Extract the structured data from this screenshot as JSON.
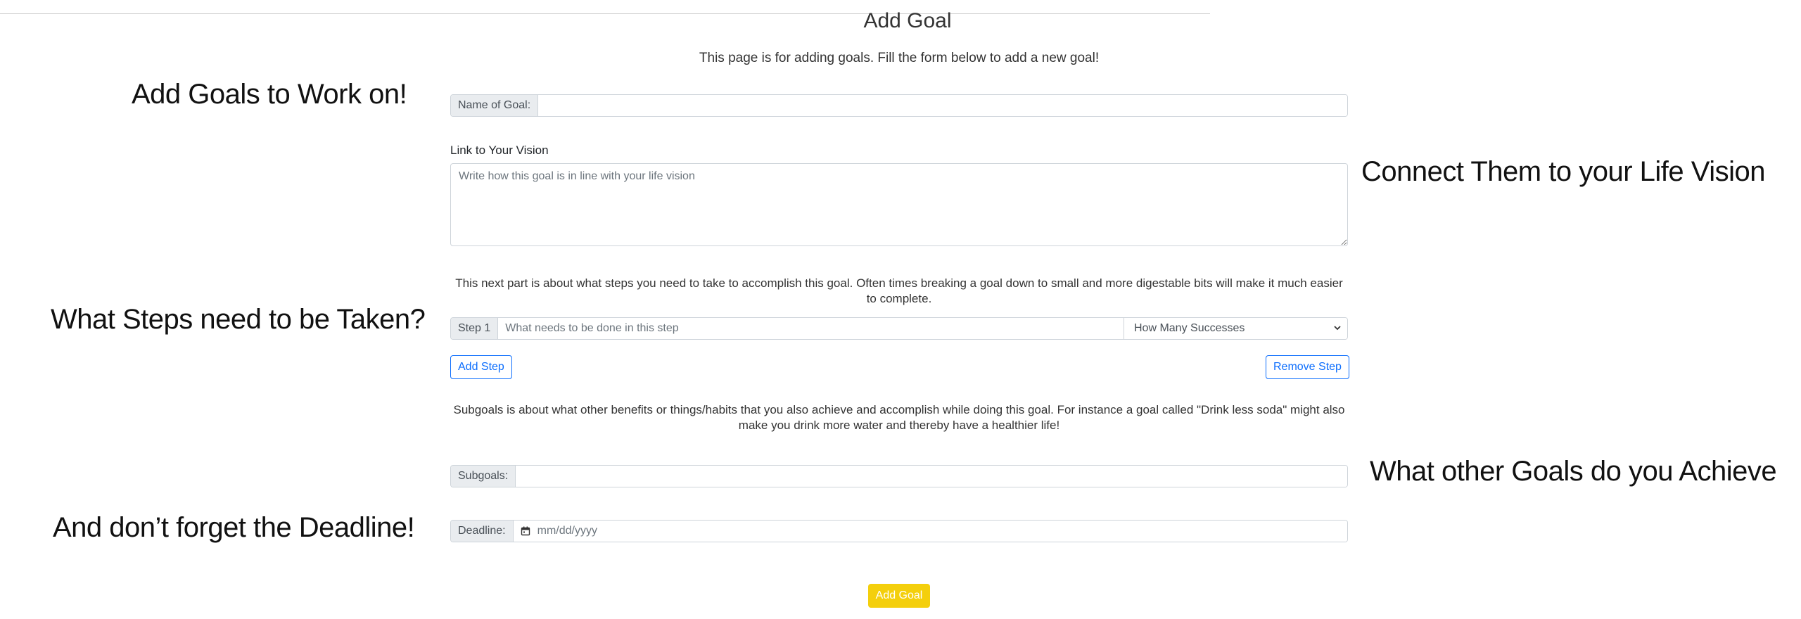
{
  "page": {
    "title": "Add Goal",
    "intro": "This page is for adding goals. Fill the form below to add a new goal!"
  },
  "annotations": {
    "goals": "Add Goals to Work on!",
    "vision": "Connect Them to your Life Vision",
    "steps": "What Steps need to be Taken?",
    "subgoals": "What other Goals do you Achieve",
    "deadline": "And don’t forget the Deadline!"
  },
  "form": {
    "name_label": "Name of Goal:",
    "name_value": "",
    "vision_label": "Link to Your Vision",
    "vision_placeholder": "Write how this goal is in line with your life vision",
    "steps_help": "This next part is about what steps you need to take to accomplish this goal. Often times breaking a goal down to small and more digestable bits will make it much easier to complete.",
    "step_label": "Step 1",
    "step_placeholder": "What needs to be done in this step",
    "successes_selected": "How Many Successes",
    "add_step": "Add Step",
    "remove_step": "Remove Step",
    "subgoals_help": "Subgoals is about what other benefits or things/habits that you also achieve and accomplish while doing this goal. For instance a goal called \"Drink less soda\" might also make you drink more water and thereby have a healthier life!",
    "subgoals_label": "Subgoals:",
    "subgoals_value": "",
    "deadline_label": "Deadline:",
    "deadline_placeholder": "mm/dd/yyyy",
    "submit": "Add Goal"
  },
  "icons": {
    "calendar": "calendar-icon",
    "dropdown": "chevron-down-icon"
  },
  "colors": {
    "primary": "#0d6efd",
    "warning": "#f4cf0c",
    "addon_bg": "#e9ecef",
    "border": "#ced4da"
  }
}
